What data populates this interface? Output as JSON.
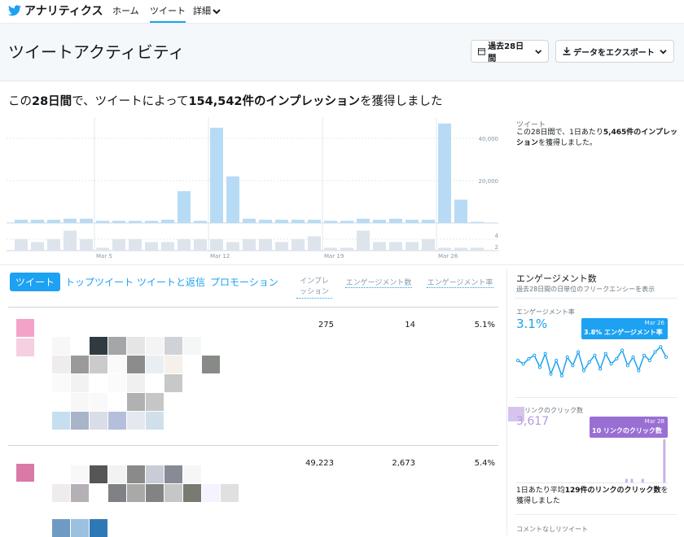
{
  "nav": {
    "brand": "アナリティクス",
    "items": [
      "ホーム",
      "ツイート",
      "詳細"
    ],
    "active_index": 1
  },
  "header": {
    "title": "ツイートアクティビティ",
    "period_button": "過去28日間",
    "export_button": "データをエクスポート"
  },
  "summary": {
    "prefix": "この",
    "days": "28日間",
    "middle": "で、ツイートによって",
    "impressions": "154,542件のインプレッション",
    "suffix": "を獲得しました"
  },
  "chart_data": {
    "type": "bar",
    "categories": [
      "Feb 28",
      "Mar 1",
      "Mar 2",
      "Mar 3",
      "Mar 4",
      "Mar 5",
      "Mar 6",
      "Mar 7",
      "Mar 8",
      "Mar 9",
      "Mar 10",
      "Mar 11",
      "Mar 12",
      "Mar 13",
      "Mar 14",
      "Mar 15",
      "Mar 16",
      "Mar 17",
      "Mar 18",
      "Mar 19",
      "Mar 20",
      "Mar 21",
      "Mar 22",
      "Mar 23",
      "Mar 24",
      "Mar 25",
      "Mar 26",
      "Mar 27",
      "Mar 28"
    ],
    "series": [
      {
        "values": [
          1500,
          1500,
          1500,
          2000,
          2000,
          1000,
          1000,
          1000,
          1000,
          1500,
          15000,
          1000,
          45000,
          22000,
          2000,
          1500,
          1500,
          1500,
          1500,
          1000,
          1000,
          2000,
          1500,
          2000,
          1500,
          1500,
          47000,
          11000,
          500
        ]
      },
      {
        "values": [
          4,
          3,
          4,
          7,
          4,
          1,
          4,
          4,
          3,
          3,
          4,
          4,
          4,
          3,
          4,
          4,
          3,
          4,
          5,
          1,
          1,
          7,
          3,
          3,
          3,
          4,
          1,
          1,
          1
        ]
      }
    ],
    "x_tick_labels": [
      "Mar 5",
      "Mar 12",
      "Mar 19",
      "Mar 26"
    ],
    "y_tick_labels_top": [
      "40,000",
      "20,000"
    ],
    "y_tick_labels_bottom": [
      "4",
      "2"
    ],
    "ylim_top": [
      0,
      50000
    ],
    "ylim_bottom": [
      0,
      8
    ]
  },
  "side_summary": {
    "heading": "ツイート",
    "text_before": "この28日間で、1日あたり",
    "bold": "5,465件のインプレッション",
    "text_after": "を獲得しました。"
  },
  "tabs": [
    "ツイート",
    "トップツイート",
    "ツイートと返信",
    "プロモーション"
  ],
  "columns": [
    "インプレッション",
    "エンゲージメント数",
    "エンゲージメント率"
  ],
  "rows": [
    {
      "impressions": "275",
      "engagements": "14",
      "rate": "5.1%"
    },
    {
      "impressions": "49,223",
      "engagements": "2,673",
      "rate": "5.4%"
    }
  ],
  "engagement_panel": {
    "title": "エンゲージメント数",
    "subtitle": "過去28日間の日単位のフリークエンシーを表示",
    "rate_label": "エンゲージメント率",
    "rate_value": "3.1%",
    "rate_tooltip_date": "Mar 26",
    "rate_tooltip_text": "3.8% エンゲージメント率",
    "rate_series": [
      3.0,
      2.8,
      3.1,
      3.3,
      2.6,
      3.4,
      2.2,
      3.0,
      2.1,
      3.2,
      2.7,
      3.5,
      2.4,
      2.9,
      3.3,
      2.5,
      3.4,
      2.8,
      3.1,
      3.6,
      2.7,
      3.2,
      2.4,
      3.3,
      3.0,
      3.5,
      3.8,
      3.2
    ],
    "click_label": "リンクのクリック数",
    "click_value": "3,617",
    "click_tooltip_date": "Mar 28",
    "click_tooltip_text": "10 リンクのクリック数",
    "click_series": [
      0,
      0,
      0,
      0,
      0,
      0,
      0,
      0,
      0,
      0,
      0,
      0,
      0,
      0,
      0,
      0,
      0,
      0,
      0,
      0,
      1,
      1,
      0,
      1,
      0,
      0,
      0,
      10
    ],
    "click_summary_before": "1日あたり平均",
    "click_summary_bold": "129件のリンクのクリック数",
    "click_summary_after": "を獲得しました",
    "next_label": "コメントなしリツイート"
  },
  "colors": {
    "accent": "#1da1f2",
    "bar_top": "#b7dbf5",
    "bar_bottom": "#dde4ec",
    "purple": "#a57ed6",
    "purple_dark": "#8a60c9"
  }
}
